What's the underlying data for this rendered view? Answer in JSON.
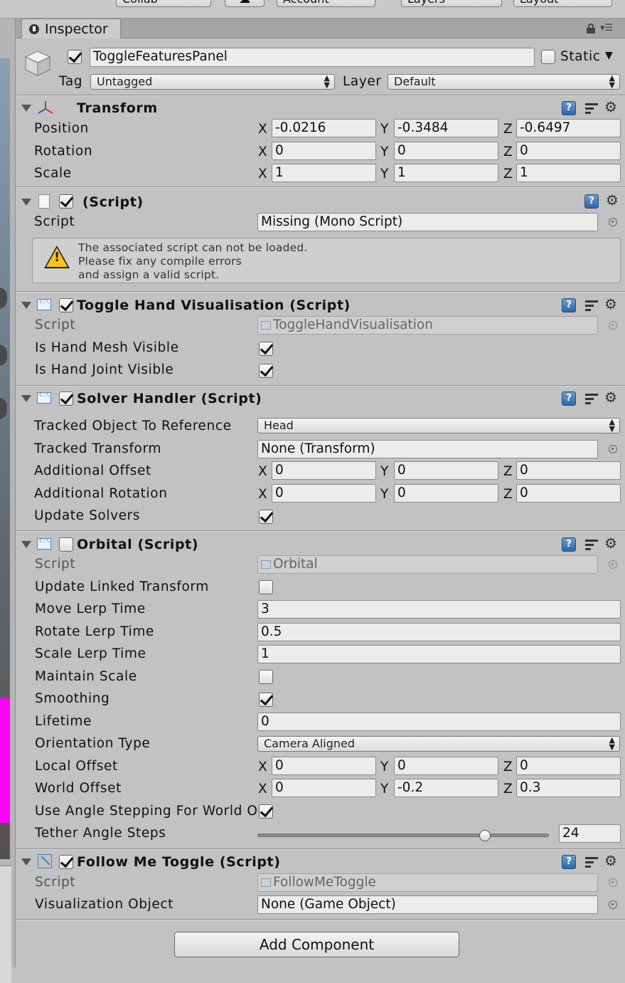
{
  "toolbar": {
    "collab": "Collab",
    "cloud": "☁",
    "account": "Account",
    "layers": "Layers",
    "layout": "Layout"
  },
  "tab": {
    "label": "Inspector"
  },
  "object": {
    "active": true,
    "name": "ToggleFeaturesPanel",
    "static_label": "Static",
    "static": false,
    "tag_label": "Tag",
    "tag_value": "Untagged",
    "layer_label": "Layer",
    "layer_value": "Default"
  },
  "transform": {
    "title": "Transform",
    "position": {
      "label": "Position",
      "x": "-0.0216",
      "y": "-0.3484",
      "z": "-0.6497"
    },
    "rotation": {
      "label": "Rotation",
      "x": "0",
      "y": "0",
      "z": "0"
    },
    "scale": {
      "label": "Scale",
      "x": "1",
      "y": "1",
      "z": "1"
    }
  },
  "axes": {
    "x": "X",
    "y": "Y",
    "z": "Z"
  },
  "missing_script": {
    "enabled": true,
    "title": "(Script)",
    "script_label": "Script",
    "script_value": "Missing (Mono Script)",
    "warning_line1": "The associated script can not be loaded.",
    "warning_line2": "Please fix any compile errors",
    "warning_line3": "and assign a valid script."
  },
  "toggle_hand": {
    "enabled": true,
    "title": "Toggle Hand Visualisation (Script)",
    "script_label": "Script",
    "script_value": "ToggleHandVisualisation",
    "mesh_label": "Is Hand Mesh Visible",
    "mesh": true,
    "joint_label": "Is Hand Joint Visible",
    "joint": true
  },
  "solver_handler": {
    "enabled": true,
    "title": "Solver Handler (Script)",
    "tracked_ref_label": "Tracked Object To Reference",
    "tracked_ref_value": "Head",
    "tracked_transform_label": "Tracked Transform",
    "tracked_transform_value": "None (Transform)",
    "offset": {
      "label": "Additional Offset",
      "x": "0",
      "y": "0",
      "z": "0"
    },
    "rotation": {
      "label": "Additional Rotation",
      "x": "0",
      "y": "0",
      "z": "0"
    },
    "update_label": "Update Solvers",
    "update": true
  },
  "orbital": {
    "enabled": false,
    "title": "Orbital (Script)",
    "script_label": "Script",
    "script_value": "Orbital",
    "update_linked_label": "Update Linked Transform",
    "update_linked": false,
    "move_lerp_label": "Move Lerp Time",
    "move_lerp": "3",
    "rotate_lerp_label": "Rotate Lerp Time",
    "rotate_lerp": "0.5",
    "scale_lerp_label": "Scale Lerp Time",
    "scale_lerp": "1",
    "maintain_scale_label": "Maintain Scale",
    "maintain_scale": false,
    "smoothing_label": "Smoothing",
    "smoothing": true,
    "lifetime_label": "Lifetime",
    "lifetime": "0",
    "orientation_label": "Orientation Type",
    "orientation_value": "Camera Aligned",
    "local_offset": {
      "label": "Local Offset",
      "x": "0",
      "y": "0",
      "z": "0"
    },
    "world_offset": {
      "label": "World Offset",
      "x": "0",
      "y": "-0.2",
      "z": "0.3"
    },
    "angle_stepping_label": "Use Angle Stepping For World O",
    "angle_stepping": true,
    "tether_label": "Tether Angle Steps",
    "tether_value": "24",
    "tether_fraction": 0.78
  },
  "follow_me": {
    "enabled": true,
    "title": "Follow Me Toggle (Script)",
    "script_label": "Script",
    "script_value": "FollowMeToggle",
    "vis_label": "Visualization Object",
    "vis_value": "None (Game Object)"
  },
  "add_component": "Add Component"
}
